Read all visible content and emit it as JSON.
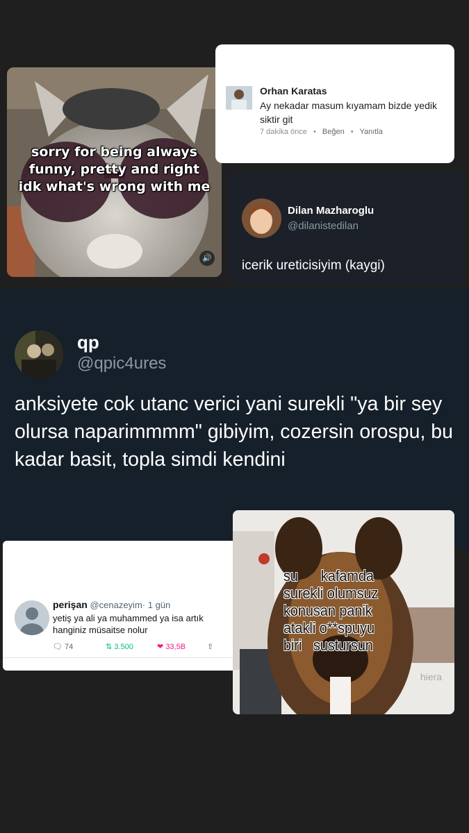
{
  "cat_card": {
    "caption": [
      "sorry for being always",
      "funny, pretty and right",
      "idk what's wrong with me"
    ],
    "icon": "sound-icon"
  },
  "orhan_card": {
    "name": "Orhan Karatas",
    "text": "Ay nekadar masum kıyamam bizde yedik siktir git",
    "time": "7 dakika önce",
    "sep": "•",
    "like": "Beğen",
    "reply": "Yanıtla"
  },
  "dilan_card": {
    "name": "Dilan Mazharoglu",
    "handle": "@dilanistedilan",
    "text": "icerik ureticisiyim (kaygi)"
  },
  "main_tweet": {
    "name": "qp",
    "handle": "@qpic4ures",
    "text": "anksiyete cok utanc verici yani surekli \"ya bir sey olursa naparimmmm\" gibiyim, cozersin orospu, bu kadar basit, topla simdi kendini"
  },
  "perisan_card": {
    "name": "perişan",
    "handle": "@cenazeyim",
    "time": "· 1 gün",
    "text": "yetiş ya ali ya muhammed ya isa artık hanginiz müsaitse nolur",
    "replies": "74",
    "retweets": "3.500",
    "likes": "33,5B",
    "colors": {
      "retweet": "#00ba7c",
      "like": "#f91880"
    }
  },
  "dog_card": {
    "lines": [
      "su      kafamda",
      "surekli olumsuz",
      "konusan panik",
      "atakli o**spuyu",
      "biri   sustursun"
    ],
    "watermark": "hiera"
  }
}
